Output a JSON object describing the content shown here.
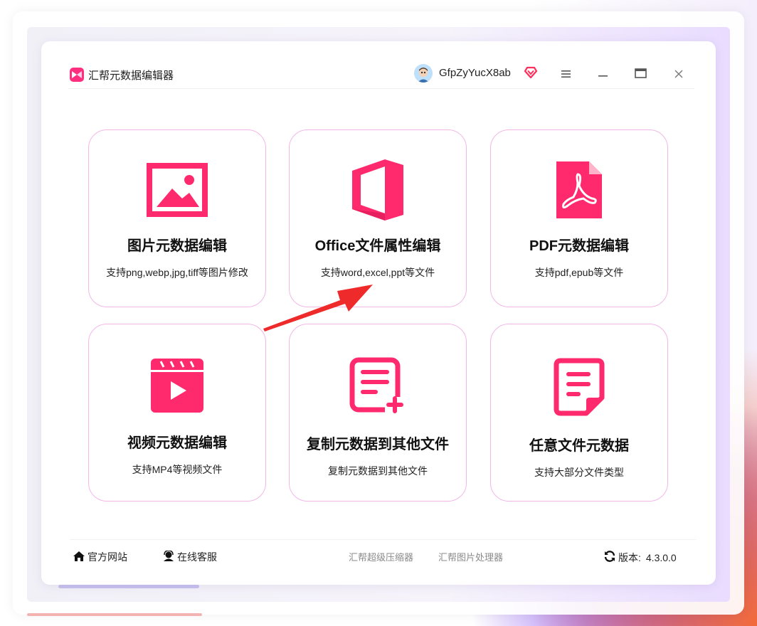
{
  "app": {
    "title": "汇帮元数据编辑器",
    "username": "GfpZyYucX8ab",
    "brand_color": "#ff2e7e"
  },
  "titlebar_icons": [
    "app-logo-icon",
    "avatar",
    "vip-icon",
    "menu-icon",
    "minimize-icon",
    "maximize-icon",
    "close-icon"
  ],
  "cards": [
    {
      "title": "图片元数据编辑",
      "desc": "支持png,webp,jpg,tiff等图片修改",
      "icon": "image-icon"
    },
    {
      "title": "Office文件属性编辑",
      "desc": "支持word,excel,ppt等文件",
      "icon": "office-icon"
    },
    {
      "title": "PDF元数据编辑",
      "desc": "支持pdf,epub等文件",
      "icon": "pdf-icon"
    },
    {
      "title": "视频元数据编辑",
      "desc": "支持MP4等视频文件",
      "icon": "video-icon"
    },
    {
      "title": "复制元数据到其他文件",
      "desc": "复制元数据到其他文件",
      "icon": "copy-document-icon"
    },
    {
      "title": "任意文件元数据",
      "desc": "支持大部分文件类型",
      "icon": "file-icon"
    }
  ],
  "footer": {
    "website": "官方网站",
    "support": "在线客服",
    "link1": "汇帮超级压缩器",
    "link2": "汇帮图片处理器",
    "version_label": "版本:",
    "version": "4.3.0.0"
  },
  "annotation_color": "#ee2a2a"
}
